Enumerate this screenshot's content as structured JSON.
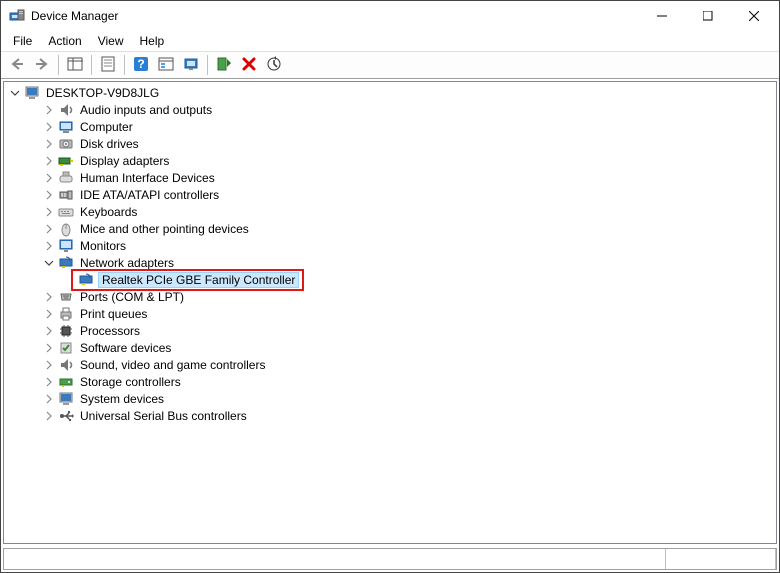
{
  "window": {
    "title": "Device Manager"
  },
  "menu": {
    "file": "File",
    "action": "Action",
    "view": "View",
    "help": "Help"
  },
  "tree": {
    "root": "DESKTOP-V9D8JLG",
    "items": [
      {
        "label": "Audio inputs and outputs",
        "expandable": true
      },
      {
        "label": "Computer",
        "expandable": true
      },
      {
        "label": "Disk drives",
        "expandable": true
      },
      {
        "label": "Display adapters",
        "expandable": true
      },
      {
        "label": "Human Interface Devices",
        "expandable": true
      },
      {
        "label": "IDE ATA/ATAPI controllers",
        "expandable": true
      },
      {
        "label": "Keyboards",
        "expandable": true
      },
      {
        "label": "Mice and other pointing devices",
        "expandable": true
      },
      {
        "label": "Monitors",
        "expandable": true
      },
      {
        "label": "Network adapters",
        "expandable": true,
        "expanded": true
      },
      {
        "label": "Ports (COM & LPT)",
        "expandable": true
      },
      {
        "label": "Print queues",
        "expandable": true
      },
      {
        "label": "Processors",
        "expandable": true
      },
      {
        "label": "Software devices",
        "expandable": true
      },
      {
        "label": "Sound, video and game controllers",
        "expandable": true
      },
      {
        "label": "Storage controllers",
        "expandable": true
      },
      {
        "label": "System devices",
        "expandable": true
      },
      {
        "label": "Universal Serial Bus controllers",
        "expandable": true
      }
    ],
    "network_child": "Realtek PCIe GBE Family Controller"
  },
  "icons": {
    "app": "device-manager-icon",
    "back": "back-arrow-icon",
    "forward": "forward-arrow-icon",
    "show_hide": "show-hide-tree-icon",
    "properties": "properties-icon",
    "help": "help-icon",
    "view_devices": "view-devices-icon",
    "update": "update-driver-icon",
    "uninstall": "uninstall-icon",
    "scan": "scan-hardware-icon",
    "delete": "delete-icon"
  }
}
